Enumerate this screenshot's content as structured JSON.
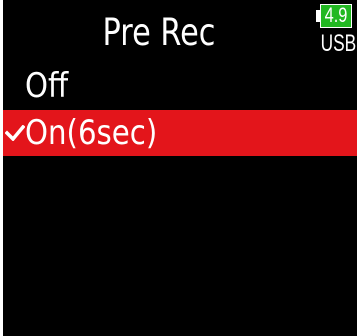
{
  "header": {
    "title": "Pre Rec",
    "battery_level": "4.9",
    "power_source": "USB",
    "battery_color": "#22b822"
  },
  "options": [
    {
      "label": "Off",
      "selected": false
    },
    {
      "label": "On(6sec)",
      "selected": true,
      "icon": "checkmark-icon"
    }
  ],
  "colors": {
    "background": "#000000",
    "selection": "#e3151b",
    "text": "#ffffff"
  }
}
